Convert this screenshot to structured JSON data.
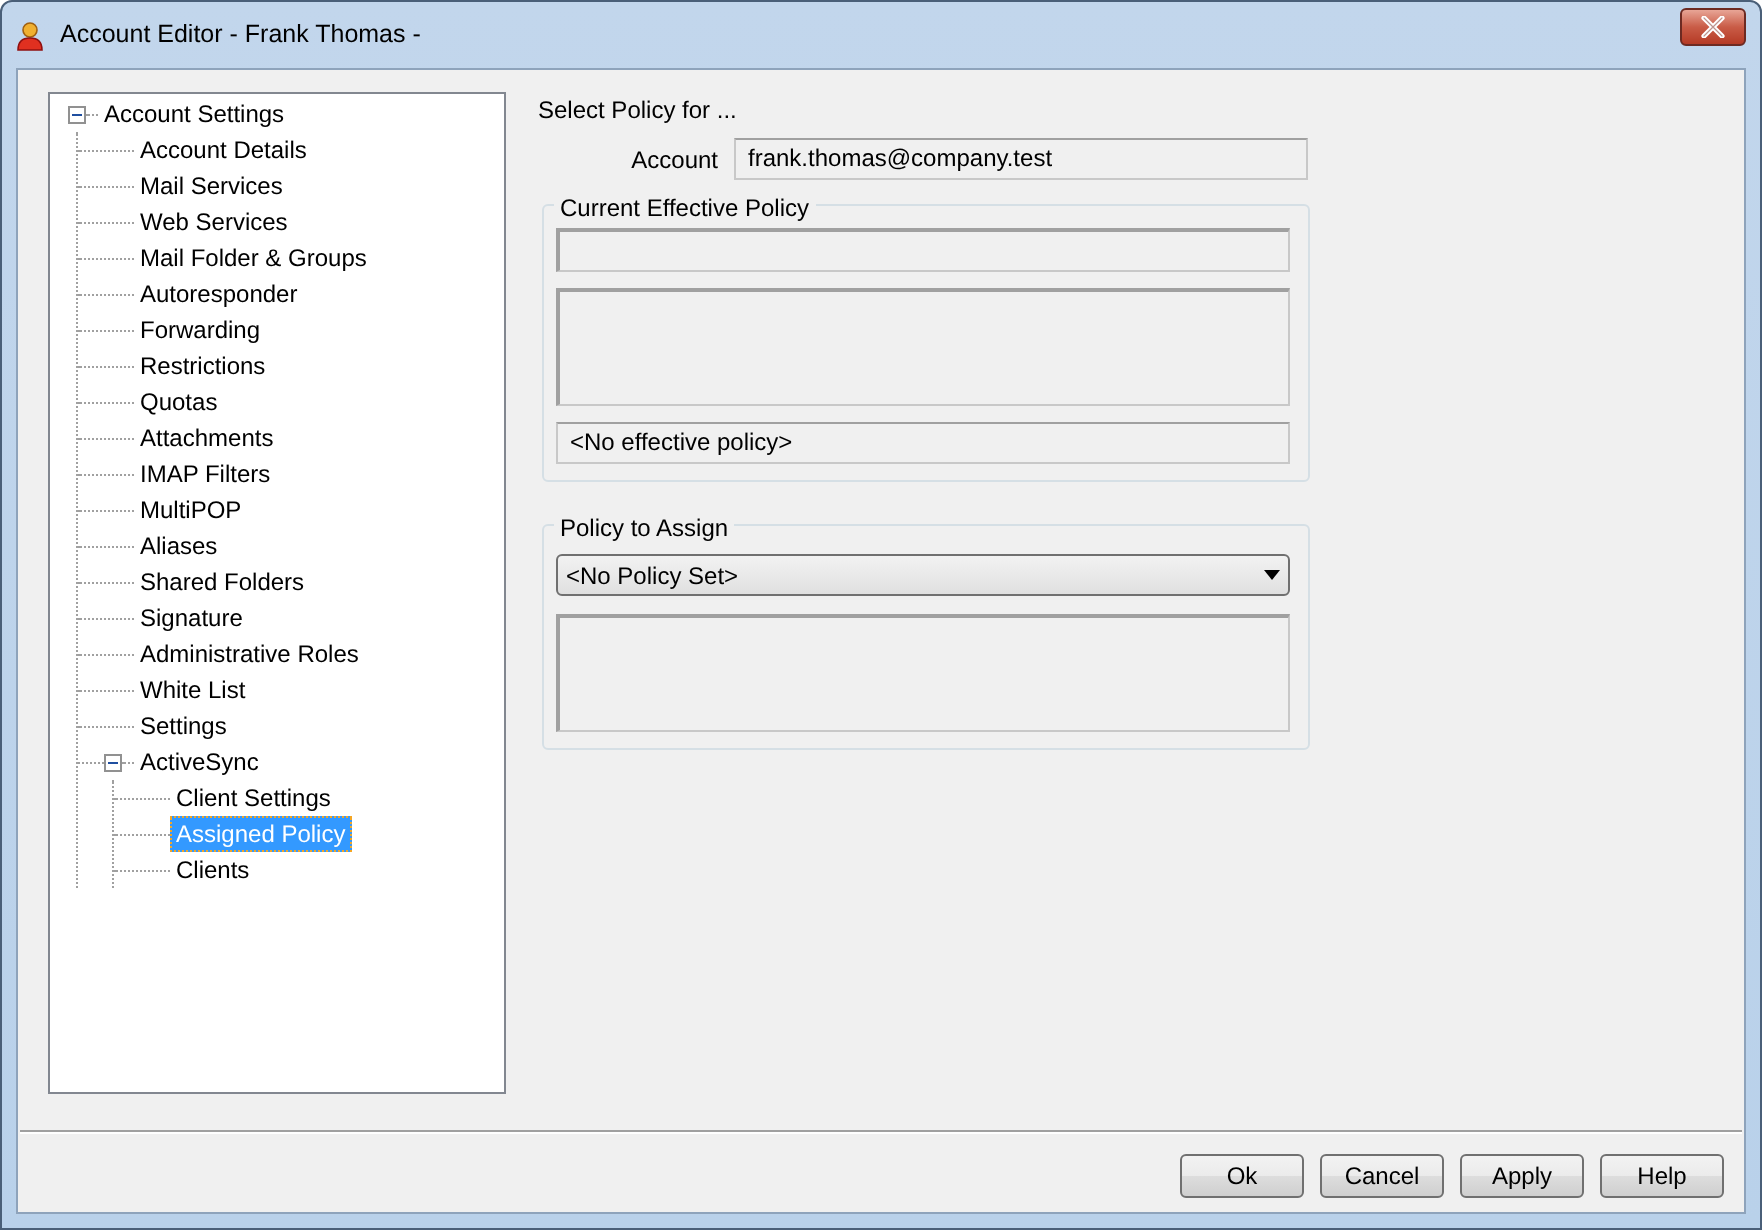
{
  "window": {
    "title": "Account Editor - Frank Thomas -"
  },
  "tree": [
    {
      "label": "Account Settings",
      "expanded": true,
      "selected": false,
      "children": [
        {
          "label": "Account Details",
          "selected": false
        },
        {
          "label": "Mail Services",
          "selected": false
        },
        {
          "label": "Web Services",
          "selected": false
        },
        {
          "label": "Mail Folder & Groups",
          "selected": false
        },
        {
          "label": "Autoresponder",
          "selected": false
        },
        {
          "label": "Forwarding",
          "selected": false
        },
        {
          "label": "Restrictions",
          "selected": false
        },
        {
          "label": "Quotas",
          "selected": false
        },
        {
          "label": "Attachments",
          "selected": false
        },
        {
          "label": "IMAP Filters",
          "selected": false
        },
        {
          "label": "MultiPOP",
          "selected": false
        },
        {
          "label": "Aliases",
          "selected": false
        },
        {
          "label": "Shared Folders",
          "selected": false
        },
        {
          "label": "Signature",
          "selected": false
        },
        {
          "label": "Administrative Roles",
          "selected": false
        },
        {
          "label": "White List",
          "selected": false
        },
        {
          "label": "Settings",
          "selected": false
        },
        {
          "label": "ActiveSync",
          "expanded": true,
          "selected": false,
          "children": [
            {
              "label": "Client Settings",
              "selected": false
            },
            {
              "label": "Assigned Policy",
              "selected": true
            },
            {
              "label": "Clients",
              "selected": false
            }
          ]
        }
      ]
    }
  ],
  "form": {
    "heading": "Select Policy for ...",
    "account_label": "Account",
    "account_value": "frank.thomas@company.test",
    "current_policy": {
      "title": "Current Effective Policy",
      "status": "<No effective policy>"
    },
    "policy_to_assign": {
      "title": "Policy to Assign",
      "value": "<No Policy Set>"
    }
  },
  "buttons": [
    "Ok",
    "Cancel",
    "Apply",
    "Help"
  ]
}
